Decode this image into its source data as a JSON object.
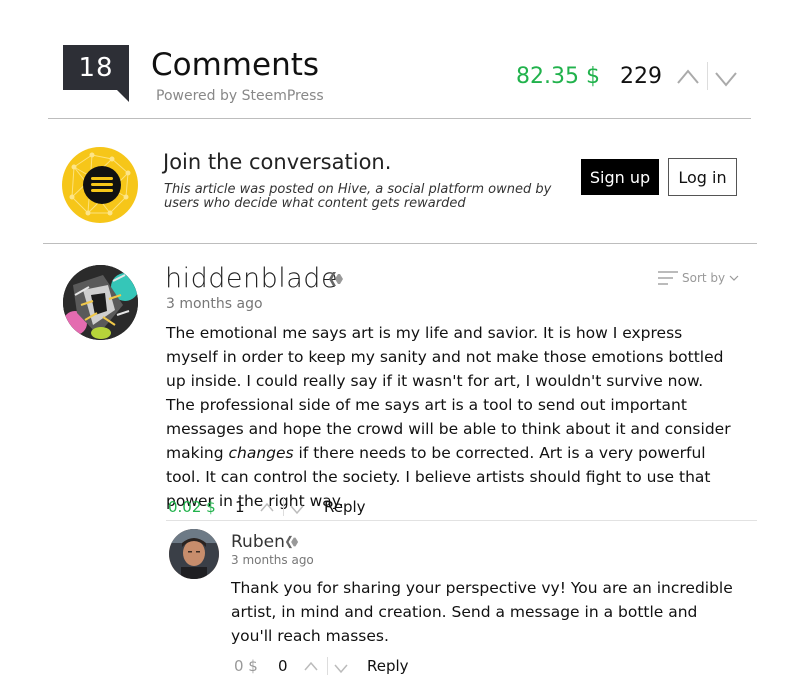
{
  "header": {
    "comment_count": "18",
    "title": "Comments",
    "powered_by": "Powered by SteemPress",
    "payout": "82.35 $",
    "votes": "229"
  },
  "join": {
    "title": "Join the conversation.",
    "description": "This article was posted on Hive, a social platform owned by users who decide what content gets rewarded",
    "signup_label": "Sign up",
    "login_label": "Log in"
  },
  "sort": {
    "label": "Sort by"
  },
  "comments": [
    {
      "author": "hiddenblade",
      "time": "3 months ago",
      "body_before": "The emotional me says art is my life and savior. It is how I express myself in order to keep my sanity and not make those emotions bottled up inside. I could really say if it wasn't for art, I wouldn't survive now. The professional side of me says art is a tool to send out important messages and hope the crowd will be able to think about it and consider making ",
      "body_emphasis": "changes",
      "body_after": " if there needs to be corrected. Art is a very powerful tool. It can control the society. I believe artists should fight to use that power in the right way.",
      "payout": "0.02 $",
      "votes": "1",
      "reply_label": "Reply",
      "payout_color": "#21b24c"
    },
    {
      "author": "Ruben",
      "time": "3 months ago",
      "body": "Thank you for sharing your perspective vy! You are an incredible artist, in mind and creation. Send a message in a bottle and you'll reach masses.",
      "payout": "0 $",
      "votes": "0",
      "reply_label": "Reply",
      "payout_color": "#999999"
    }
  ],
  "colors": {
    "accent_green": "#21b24c",
    "count_box": "#2d2f36",
    "hive_yellow": "#f6c619"
  }
}
